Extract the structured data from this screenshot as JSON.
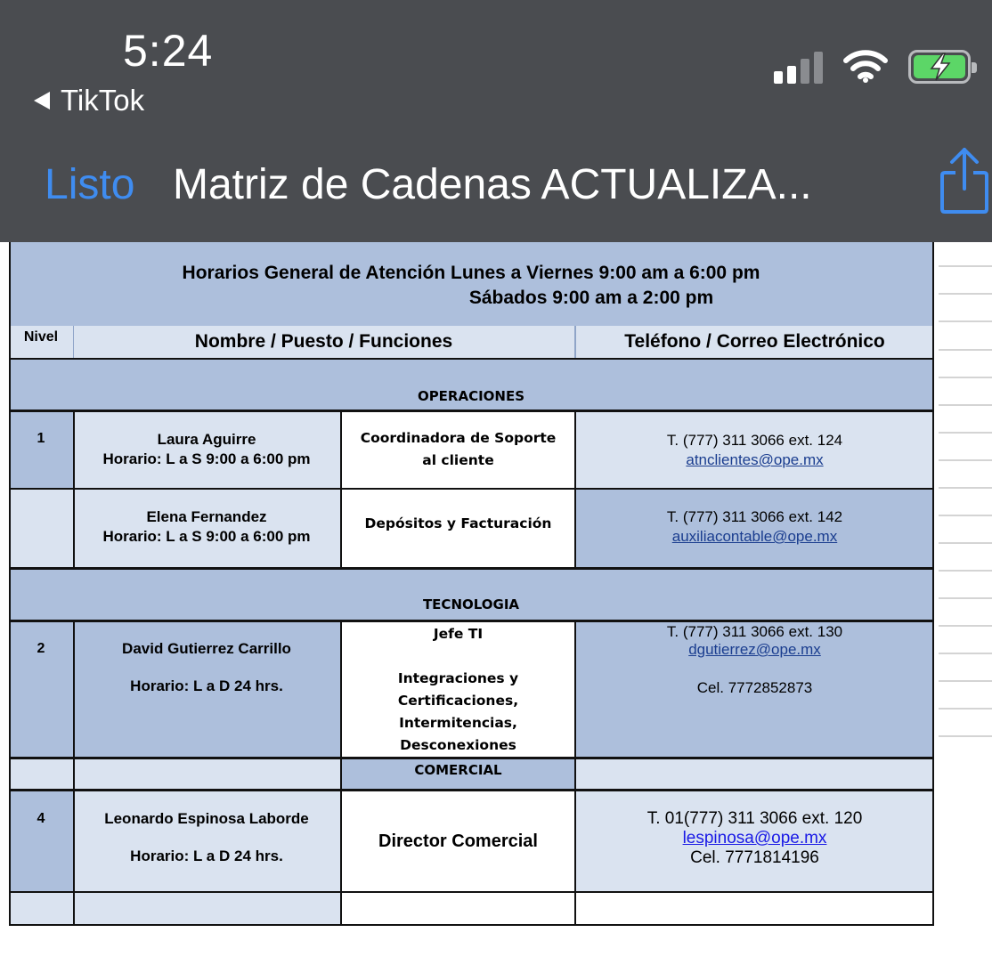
{
  "status_bar": {
    "time": "5:24",
    "back_app": "TikTok",
    "icons": [
      "cellular-signal-icon",
      "wifi-icon",
      "battery-charging-icon"
    ]
  },
  "nav": {
    "done_label": "Listo",
    "title": "Matriz de Cadenas ACTUALIZA...",
    "share_icon": "share-icon"
  },
  "colors": {
    "header_blue": "#adbfdc",
    "light_blue": "#dae3f0",
    "link_blue": "#3f8cf0",
    "chrome_gray": "#4a4c50",
    "battery_green": "#5cd667"
  },
  "sheet": {
    "header_line1": "Horarios General de Atención Lunes a Viernes 9:00 am a 6:00 pm",
    "header_line2": "Sábados 9:00 am a 2:00 pm",
    "col_nivel": "Nivel",
    "col_nombre": "Nombre / Puesto / Funciones",
    "col_contacto": "Teléfono / Correo Electrónico",
    "sections": {
      "operaciones": "OPERACIONES",
      "tecnologia": "TECNOLOGIA",
      "comercial": "COMERCIAL"
    },
    "rows": [
      {
        "nivel": "1",
        "name": "Laura Aguirre",
        "schedule": "Horario: L a S 9:00 a 6:00 pm",
        "role_line1": "Coordinadora de Soporte",
        "role_line2": "al cliente",
        "phone": "T. (777) 311 3066 ext. 124",
        "email": "atnclientes@ope.mx"
      },
      {
        "nivel": "",
        "name": "Elena Fernandez",
        "schedule": "Horario: L a S 9:00 a 6:00 pm",
        "role_line1": "Depósitos y Facturación",
        "phone": "T. (777) 311 3066 ext. 142",
        "email": "auxiliacontable@ope.mx"
      },
      {
        "nivel": "2",
        "name": "David Gutierrez Carrillo",
        "schedule": "Horario: L a D 24 hrs.",
        "role_line1": "Jefe TI",
        "role_line2": "Integraciones y",
        "role_line3": "Certificaciones,",
        "role_line4": "Intermitencias,",
        "role_line5": "Desconexiones",
        "phone": "T. (777) 311 3066 ext. 130",
        "email": "dgutierrez@ope.mx",
        "cel": "Cel. 7772852873"
      },
      {
        "nivel": "4",
        "name": "Leonardo Espinosa Laborde",
        "schedule": "Horario: L a D 24 hrs.",
        "role_line1": "Director Comercial",
        "phone": "T. 01(777) 311 3066 ext. 120",
        "email": "lespinosa@ope.mx",
        "cel": "Cel. 7771814196"
      }
    ]
  }
}
